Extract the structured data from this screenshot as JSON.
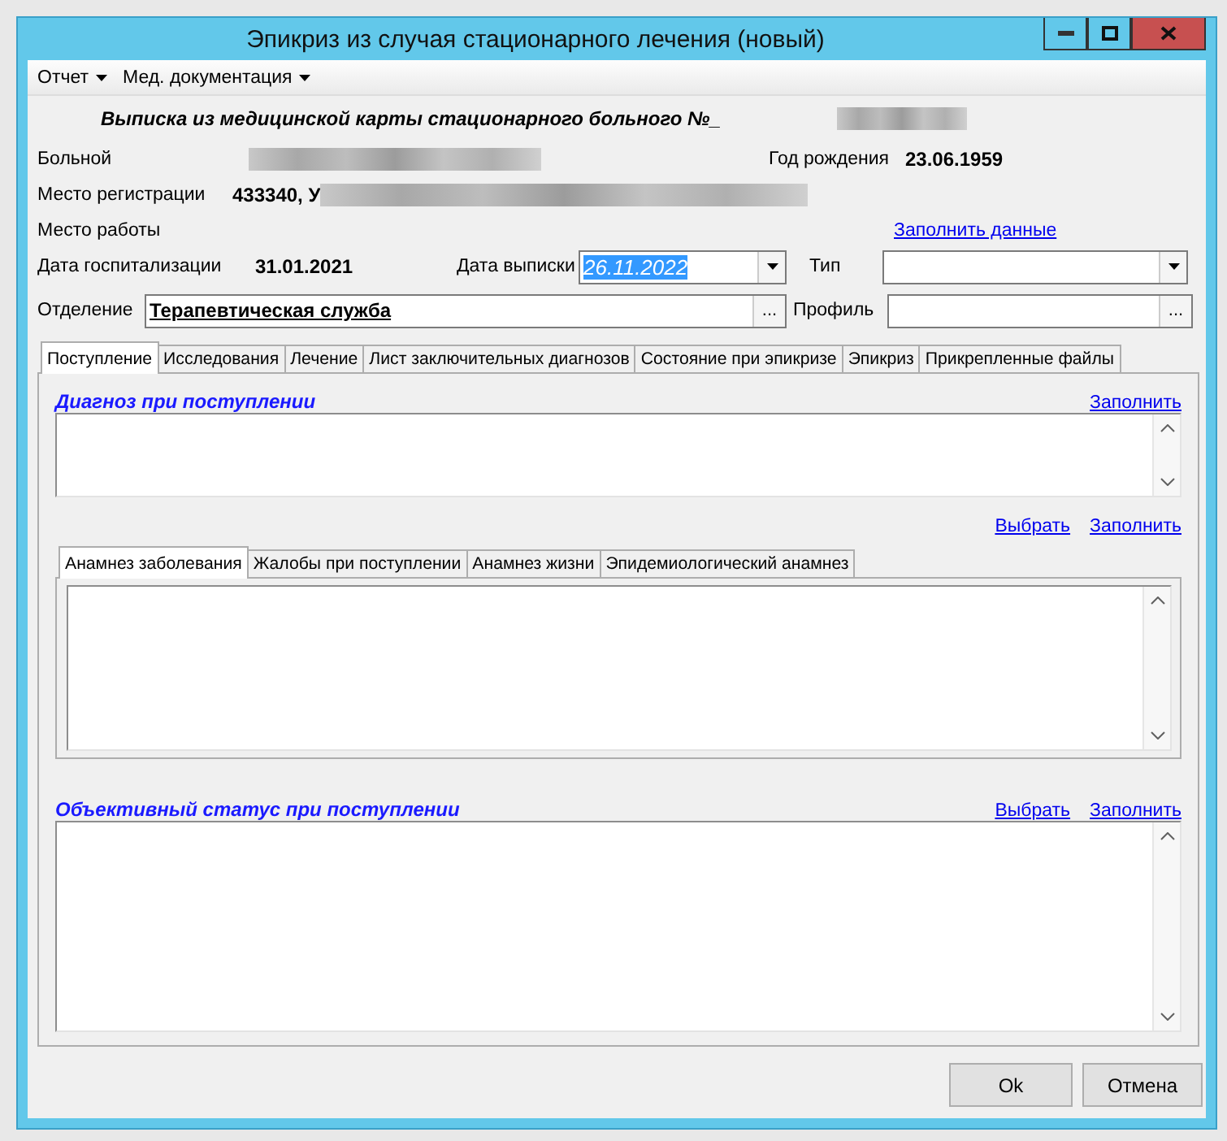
{
  "window": {
    "title": "Эпикриз из случая стационарного лечения (новый)"
  },
  "menu": [
    {
      "label": "Отчет"
    },
    {
      "label": "Мед. документация"
    }
  ],
  "header": {
    "title": "Выписка из медицинской карты стационарного больного №_"
  },
  "patient": {
    "label": "Больной"
  },
  "birth": {
    "label": "Год рождения",
    "value": "23.06.1959"
  },
  "registration": {
    "label": "Место регистрации",
    "value": "433340, У"
  },
  "work": {
    "label": "Место работы"
  },
  "fill_data_link": "Заполнить данные",
  "admission": {
    "label": "Дата госпитализации",
    "value": "31.01.2021"
  },
  "discharge": {
    "label": "Дата выписки",
    "value": "26.11.2022",
    "text_selected": true
  },
  "type": {
    "label": "Тип"
  },
  "department": {
    "label": "Отделение",
    "value": "Терапевтическая служба",
    "button": "..."
  },
  "profile": {
    "label": "Профиль",
    "button": "..."
  },
  "tabs": [
    {
      "label": "Поступление",
      "selected": true
    },
    {
      "label": "Исследования",
      "selected": false
    },
    {
      "label": "Лечение",
      "selected": false
    },
    {
      "label": "Лист заключительных диагнозов",
      "selected": false
    },
    {
      "label": "Состояние при эпикризе",
      "selected": false
    },
    {
      "label": "Эпикриз",
      "selected": false
    },
    {
      "label": "Прикрепленные файлы",
      "selected": false
    }
  ],
  "diagnosis": {
    "title": "Диагноз при поступлении",
    "links": [
      "Заполнить"
    ]
  },
  "anamnesis": {
    "links": [
      "Выбрать",
      "Заполнить"
    ],
    "tabs": [
      {
        "label": "Анамнез заболевания",
        "selected": true
      },
      {
        "label": "Жалобы при поступлении",
        "selected": false
      },
      {
        "label": "Анамнез жизни",
        "selected": false
      },
      {
        "label": "Эпидемиологический анамнез",
        "selected": false
      }
    ]
  },
  "objective": {
    "title": "Объективный статус при поступлении",
    "links": [
      "Выбрать",
      "Заполнить"
    ]
  },
  "buttons": [
    "Ok",
    "Отмена"
  ]
}
